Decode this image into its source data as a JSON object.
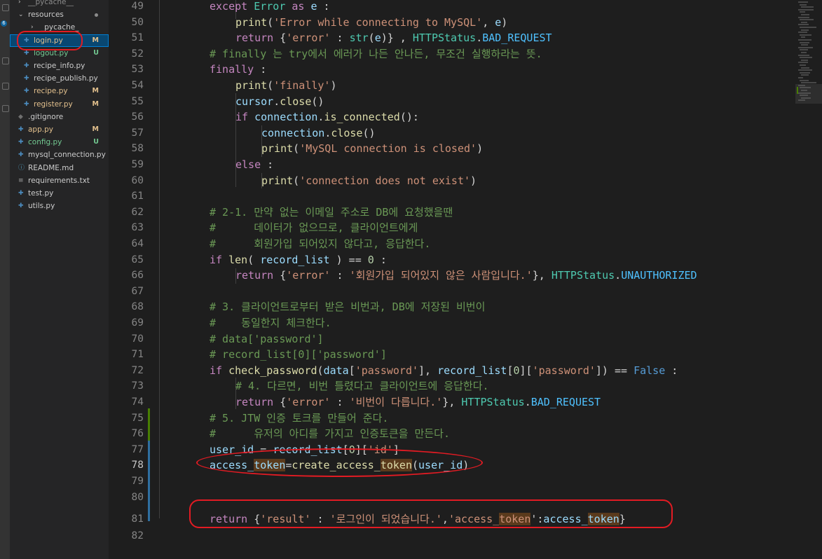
{
  "explorer": {
    "items": [
      {
        "label": "__pycache__",
        "icon": "chevron-right-icon",
        "badge": "",
        "state": "closed"
      },
      {
        "label": "resources",
        "icon": "chevron-down-icon",
        "badge": "",
        "state": "open"
      },
      {
        "label": "_pycache_",
        "icon": "chevron-right-icon",
        "badge": "",
        "state": "closed"
      },
      {
        "label": "login.py",
        "icon": "python-file-icon",
        "badge": "M",
        "state": "active"
      },
      {
        "label": "logout.py",
        "icon": "python-file-icon",
        "badge": "U"
      },
      {
        "label": "recipe_info.py",
        "icon": "python-file-icon",
        "badge": ""
      },
      {
        "label": "recipe_publish.py",
        "icon": "python-file-icon",
        "badge": ""
      },
      {
        "label": "recipe.py",
        "icon": "python-file-icon",
        "badge": "M"
      },
      {
        "label": "register.py",
        "icon": "python-file-icon",
        "badge": "M"
      },
      {
        "label": ".gitignore",
        "icon": "gitignore-file-icon",
        "badge": ""
      },
      {
        "label": "app.py",
        "icon": "python-file-icon",
        "badge": "M"
      },
      {
        "label": "config.py",
        "icon": "python-file-icon",
        "badge": "U"
      },
      {
        "label": "mysql_connection.py",
        "icon": "python-file-icon",
        "badge": ""
      },
      {
        "label": "README.md",
        "icon": "info-file-icon",
        "badge": ""
      },
      {
        "label": "requirements.txt",
        "icon": "text-file-icon",
        "badge": ""
      },
      {
        "label": "test.py",
        "icon": "python-file-icon",
        "badge": ""
      },
      {
        "label": "utils.py",
        "icon": "python-file-icon",
        "badge": ""
      }
    ]
  },
  "activity_bar": {
    "badge": "6"
  },
  "colors": {
    "modified": "#e2c08d",
    "untracked": "#73c991",
    "annotation": "#e31b23",
    "background": "#1e1e1e"
  },
  "editor": {
    "active_line": 78,
    "lines": [
      {
        "n": "49",
        "indent": 1,
        "t": [
          [
            "except",
            "kw"
          ],
          [
            " ",
            ""
          ],
          [
            "Error",
            "cl"
          ],
          [
            " ",
            ""
          ],
          [
            "as",
            "kw"
          ],
          [
            " ",
            ""
          ],
          [
            "e",
            "va"
          ],
          [
            " :",
            ""
          ]
        ]
      },
      {
        "n": "50",
        "indent": 2,
        "t": [
          [
            "print",
            "bi"
          ],
          [
            "(",
            ""
          ],
          [
            "'Error while connecting to MySQL'",
            "st"
          ],
          [
            ", ",
            ""
          ],
          [
            "e",
            "va"
          ],
          [
            ")",
            ""
          ]
        ]
      },
      {
        "n": "51",
        "indent": 2,
        "t": [
          [
            "return",
            "kw"
          ],
          [
            " {",
            ""
          ],
          [
            "'error'",
            "st"
          ],
          [
            " : ",
            ""
          ],
          [
            "str",
            "cl"
          ],
          [
            "(",
            ""
          ],
          [
            "e",
            "va"
          ],
          [
            ")} , ",
            ""
          ],
          [
            "HTTPStatus",
            "cl"
          ],
          [
            ".",
            ""
          ],
          [
            "BAD_REQUEST",
            "co"
          ]
        ]
      },
      {
        "n": "52",
        "indent": 1,
        "t": [
          [
            "# finally 는 try에서 에러가 나든 안나든, 무조건 실행하라는 뜻.",
            "cm"
          ]
        ]
      },
      {
        "n": "53",
        "indent": 1,
        "t": [
          [
            "finally",
            "kw"
          ],
          [
            " :",
            ""
          ]
        ]
      },
      {
        "n": "54",
        "indent": 2,
        "t": [
          [
            "print",
            "bi"
          ],
          [
            "(",
            ""
          ],
          [
            "'finally'",
            "st"
          ],
          [
            ")",
            ""
          ]
        ]
      },
      {
        "n": "55",
        "indent": 2,
        "t": [
          [
            "cursor",
            "va"
          ],
          [
            ".",
            ""
          ],
          [
            "close",
            "bi"
          ],
          [
            "()",
            ""
          ]
        ]
      },
      {
        "n": "56",
        "indent": 2,
        "t": [
          [
            "if",
            "kw"
          ],
          [
            " ",
            ""
          ],
          [
            "connection",
            "va"
          ],
          [
            ".",
            ""
          ],
          [
            "is_connected",
            "bi"
          ],
          [
            "():",
            ""
          ]
        ]
      },
      {
        "n": "57",
        "indent": 3,
        "t": [
          [
            "connection",
            "va"
          ],
          [
            ".",
            ""
          ],
          [
            "close",
            "bi"
          ],
          [
            "()",
            ""
          ]
        ]
      },
      {
        "n": "58",
        "indent": 3,
        "t": [
          [
            "print",
            "bi"
          ],
          [
            "(",
            ""
          ],
          [
            "'MySQL connection is closed'",
            "st"
          ],
          [
            ")",
            ""
          ]
        ]
      },
      {
        "n": "59",
        "indent": 2,
        "t": [
          [
            "else",
            "kw"
          ],
          [
            " :",
            ""
          ]
        ]
      },
      {
        "n": "60",
        "indent": 3,
        "t": [
          [
            "print",
            "bi"
          ],
          [
            "(",
            ""
          ],
          [
            "'connection does not exist'",
            "st"
          ],
          [
            ")",
            ""
          ]
        ]
      },
      {
        "n": "61",
        "indent": 0,
        "t": []
      },
      {
        "n": "62",
        "indent": 1,
        "t": [
          [
            "# 2-1. 만약 없는 이메일 주소로 DB에 요청했을땐",
            "cm"
          ]
        ]
      },
      {
        "n": "63",
        "indent": 1,
        "t": [
          [
            "#      데이터가 없으므로, 클라이언트에게",
            "cm"
          ]
        ]
      },
      {
        "n": "64",
        "indent": 1,
        "t": [
          [
            "#      회원가입 되어있지 않다고, 응답한다.",
            "cm"
          ]
        ]
      },
      {
        "n": "65",
        "indent": 1,
        "t": [
          [
            "if",
            "kw"
          ],
          [
            " ",
            ""
          ],
          [
            "len",
            "bi"
          ],
          [
            "( ",
            ""
          ],
          [
            "record_list",
            "va"
          ],
          [
            " ) == ",
            ""
          ],
          [
            "0",
            "nm"
          ],
          [
            " :",
            ""
          ]
        ]
      },
      {
        "n": "66",
        "indent": 2,
        "t": [
          [
            "return",
            "kw"
          ],
          [
            " {",
            ""
          ],
          [
            "'error'",
            "st"
          ],
          [
            " : ",
            ""
          ],
          [
            "'회원가입 되어있지 않은 사람입니다.'",
            "st"
          ],
          [
            "}, ",
            ""
          ],
          [
            "HTTPStatus",
            "cl"
          ],
          [
            ".",
            ""
          ],
          [
            "UNAUTHORIZED",
            "co"
          ]
        ]
      },
      {
        "n": "67",
        "indent": 0,
        "t": []
      },
      {
        "n": "68",
        "indent": 1,
        "t": [
          [
            "# 3. 클라이언트로부터 받은 비번과, DB에 저장된 비번이",
            "cm"
          ]
        ]
      },
      {
        "n": "69",
        "indent": 1,
        "t": [
          [
            "#    동일한지 체크한다.",
            "cm"
          ]
        ]
      },
      {
        "n": "70",
        "indent": 1,
        "t": [
          [
            "# data['password']",
            "cm"
          ]
        ]
      },
      {
        "n": "71",
        "indent": 1,
        "t": [
          [
            "# record_list[0]['password']",
            "cm"
          ]
        ]
      },
      {
        "n": "72",
        "indent": 1,
        "t": [
          [
            "if",
            "kw"
          ],
          [
            " ",
            ""
          ],
          [
            "check_password",
            "bi"
          ],
          [
            "(",
            ""
          ],
          [
            "data",
            "va"
          ],
          [
            "[",
            ""
          ],
          [
            "'password'",
            "st"
          ],
          [
            "], ",
            ""
          ],
          [
            "record_list",
            "va"
          ],
          [
            "[",
            ""
          ],
          [
            "0",
            "nm"
          ],
          [
            "][",
            ""
          ],
          [
            "'password'",
            "st"
          ],
          [
            "]) == ",
            ""
          ],
          [
            "False",
            "bl"
          ],
          [
            " :",
            ""
          ]
        ]
      },
      {
        "n": "73",
        "indent": 2,
        "t": [
          [
            "# 4. 다르면, 비번 틀렸다고 클라이언트에 응답한다.",
            "cm"
          ]
        ]
      },
      {
        "n": "74",
        "indent": 2,
        "t": [
          [
            "return",
            "kw"
          ],
          [
            " {",
            ""
          ],
          [
            "'error'",
            "st"
          ],
          [
            " : ",
            ""
          ],
          [
            "'비번이 다릅니다.'",
            "st"
          ],
          [
            "}, ",
            ""
          ],
          [
            "HTTPStatus",
            "cl"
          ],
          [
            ".",
            ""
          ],
          [
            "BAD_REQUEST",
            "co"
          ]
        ]
      },
      {
        "n": "75",
        "indent": 1,
        "t": [
          [
            "# 5. JTW 인증 토크를 만들어 준다.",
            "cm"
          ]
        ]
      },
      {
        "n": "76",
        "indent": 1,
        "t": [
          [
            "#      유저의 아디를 가지고 인증토큰을 만든다.",
            "cm"
          ]
        ]
      },
      {
        "n": "77",
        "indent": 1,
        "t": [
          [
            "user_id",
            "va"
          ],
          [
            " = ",
            ""
          ],
          [
            "record_list",
            "va"
          ],
          [
            "[",
            ""
          ],
          [
            "0",
            "nm"
          ],
          [
            "][",
            ""
          ],
          [
            "'id'",
            "st"
          ],
          [
            "]",
            ""
          ]
        ]
      },
      {
        "n": "78",
        "indent": 1,
        "t": [
          [
            "access_",
            "va"
          ],
          [
            "token",
            "va hl"
          ],
          [
            "=",
            ""
          ],
          [
            "create_access_",
            "bi"
          ],
          [
            "token",
            "bi hl"
          ],
          [
            "(",
            ""
          ],
          [
            "user_id",
            "va"
          ],
          [
            ")",
            ""
          ]
        ]
      },
      {
        "n": "79",
        "indent": 0,
        "t": []
      },
      {
        "n": "80",
        "indent": 0,
        "t": []
      },
      {
        "n": "81",
        "indent": 1,
        "t": [
          [
            "return",
            "kw"
          ],
          [
            " {",
            ""
          ],
          [
            "'result'",
            "st"
          ],
          [
            " : ",
            ""
          ],
          [
            "'로그인이 되었습니다.'",
            "st"
          ],
          [
            ",",
            ""
          ],
          [
            "'access_",
            "st"
          ],
          [
            "token",
            "st hl"
          ],
          [
            "'",
            ""
          ],
          [
            ":",
            ""
          ],
          [
            "access_",
            "va"
          ],
          [
            "token",
            "va hl"
          ],
          [
            "}",
            ""
          ]
        ]
      },
      {
        "n": "82",
        "indent": 0,
        "t": []
      }
    ]
  }
}
